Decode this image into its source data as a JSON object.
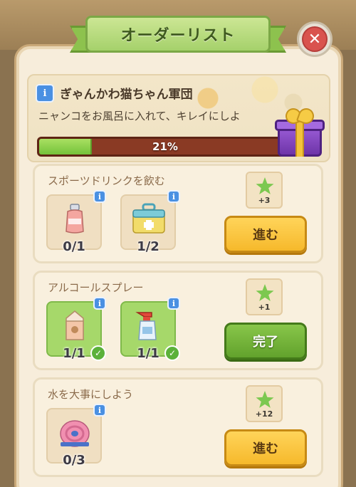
{
  "window": {
    "title": "オーダーリスト",
    "close_icon": "close-icon"
  },
  "event": {
    "title": "ぎゃんかわ猫ちゃん軍団",
    "description": "ニャンコをお風呂に入れて、キレイにしよ",
    "progress_percent": 21,
    "progress_label": "21%",
    "reward_icon": "gift-box-icon"
  },
  "tasks": [
    {
      "title": "スポーツドリンクを飲む",
      "items": [
        {
          "icon": "sports-drink-bottle-icon",
          "count": "0/1",
          "completed": false
        },
        {
          "icon": "first-aid-box-icon",
          "count": "1/2",
          "completed": false
        }
      ],
      "reward_amount": "+3",
      "button_label": "進む",
      "button_state": "go"
    },
    {
      "title": "アルコールスプレー",
      "items": [
        {
          "icon": "milk-carton-icon",
          "count": "1/1",
          "completed": true
        },
        {
          "icon": "alcohol-spray-bottle-icon",
          "count": "1/1",
          "completed": true
        }
      ],
      "reward_amount": "+1",
      "button_label": "完了",
      "button_state": "complete"
    },
    {
      "title": "水を大事にしよう",
      "items": [
        {
          "icon": "hose-reel-icon",
          "count": "0/3",
          "completed": false
        }
      ],
      "reward_amount": "+12",
      "button_label": "進む",
      "button_state": "go"
    }
  ],
  "colors": {
    "ribbon_green": "#a5d16b",
    "progress_fill": "#74c23a",
    "progress_track": "#8a3a24",
    "go_button": "#f6b92b",
    "complete_button": "#62a22c",
    "close_red": "#d9534e"
  }
}
